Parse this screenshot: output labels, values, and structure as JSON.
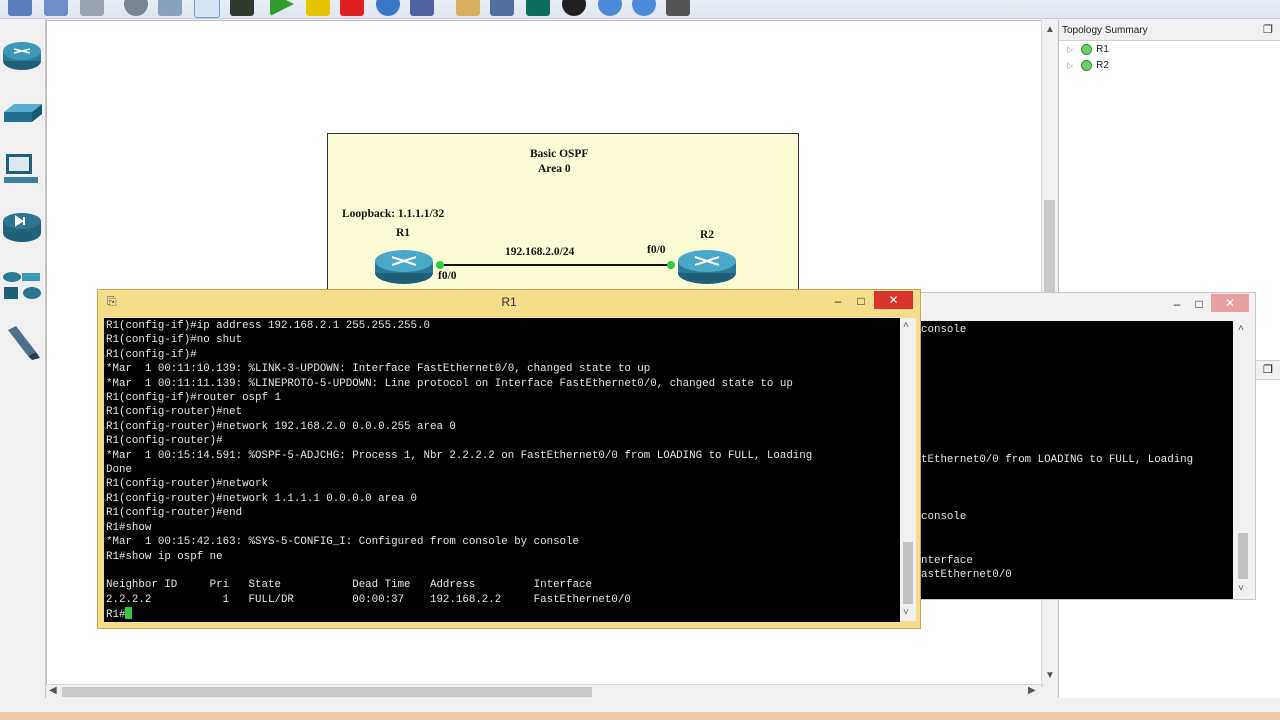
{
  "toolbar": {
    "icons": [
      "new-file-icon",
      "save-icon",
      "snapshot-icon",
      "clock-icon",
      "import-icon",
      "console-icon",
      "terminal-icon",
      "start-icon",
      "pause-icon",
      "stop-icon",
      "reload-icon",
      "shield-icon",
      "notepad-icon",
      "screenshot-icon",
      "capture-icon",
      "rack-icon",
      "zoom-in-icon",
      "zoom-out-icon",
      "camera-icon"
    ]
  },
  "left_panel": {
    "items": [
      "router-device-icon",
      "switch-device-icon",
      "end-device-icon",
      "security-device-icon",
      "all-devices-icon",
      "cable-icon"
    ]
  },
  "topology": {
    "note_title_line1": "Basic OSPF",
    "note_title_line2": "Area 0",
    "loopback_label": "Loopback: 1.1.1.1/32",
    "r1_name": "R1",
    "r2_name": "R2",
    "link_subnet": "192.168.2.0/24",
    "r1_port": "f0/0",
    "r2_port": "f0/0"
  },
  "summary": {
    "title": "Topology Summary",
    "nodes": [
      "R1",
      "R2"
    ]
  },
  "console_main": {
    "title": "R1",
    "lines": [
      "R1(config-if)#ip address 192.168.2.1 255.255.255.0",
      "R1(config-if)#no shut",
      "R1(config-if)#",
      "*Mar  1 00:11:10.139: %LINK-3-UPDOWN: Interface FastEthernet0/0, changed state to up",
      "*Mar  1 00:11:11.139: %LINEPROTO-5-UPDOWN: Line protocol on Interface FastEthernet0/0, changed state to up",
      "R1(config-if)#router ospf 1",
      "R1(config-router)#net",
      "R1(config-router)#network 192.168.2.0 0.0.0.255 area 0",
      "R1(config-router)#",
      "*Mar  1 00:15:14.591: %OSPF-5-ADJCHG: Process 1, Nbr 2.2.2.2 on FastEthernet0/0 from LOADING to FULL, Loading",
      "Done",
      "R1(config-router)#network",
      "R1(config-router)#network 1.1.1.1 0.0.0.0 area 0",
      "R1(config-router)#end",
      "R1#show",
      "*Mar  1 00:15:42.163: %SYS-5-CONFIG_I: Configured from console by console",
      "R1#show ip ospf ne",
      "",
      "Neighbor ID     Pri   State           Dead Time   Address         Interface",
      "2.2.2.2           1   FULL/DR         00:00:37    192.168.2.2     FastEthernet0/0"
    ],
    "prompt": "R1#"
  },
  "console_back": {
    "lines": [
      "console",
      "",
      "",
      "",
      "",
      "",
      "",
      "",
      "",
      "tEthernet0/0 from LOADING to FULL, Loading",
      "",
      "",
      "",
      "console",
      "",
      "",
      "nterface",
      "astEthernet0/0"
    ]
  },
  "window_controls": {
    "minimize": "–",
    "maximize": "□",
    "close": "✕"
  }
}
